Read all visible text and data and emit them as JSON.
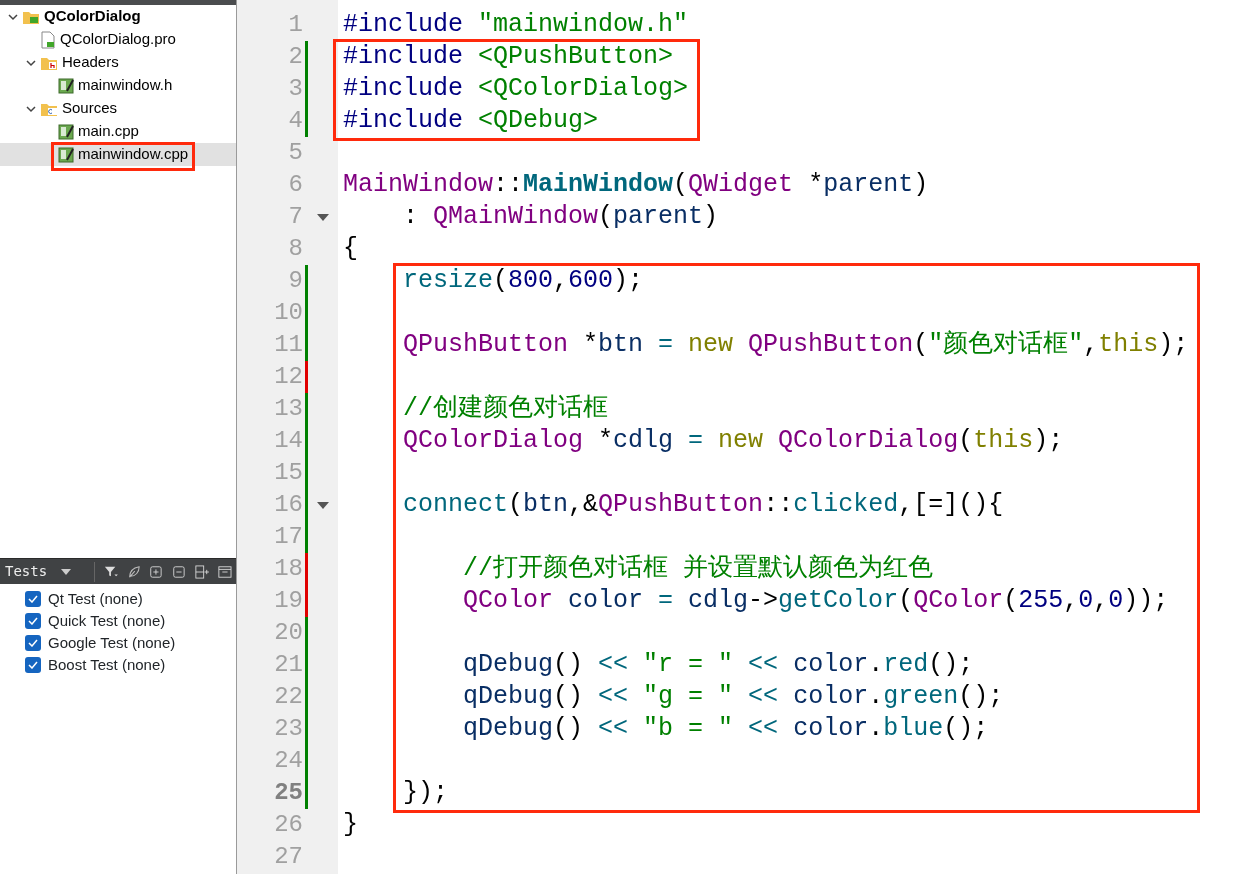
{
  "project_tree": [
    {
      "label": "QColorDialog",
      "kind": "project",
      "expanded": true,
      "selected": false,
      "highlighted": false,
      "children": [
        {
          "label": "QColorDialog.pro",
          "kind": "pro-file",
          "selected": false,
          "highlighted": false
        },
        {
          "label": "Headers",
          "kind": "header-folder",
          "expanded": true,
          "selected": false,
          "highlighted": false,
          "children": [
            {
              "label": "mainwindow.h",
              "kind": "source-file",
              "selected": false,
              "highlighted": false
            }
          ]
        },
        {
          "label": "Sources",
          "kind": "source-folder",
          "expanded": true,
          "selected": false,
          "highlighted": false,
          "children": [
            {
              "label": "main.cpp",
              "kind": "source-file",
              "selected": false,
              "highlighted": false
            },
            {
              "label": "mainwindow.cpp",
              "kind": "source-file",
              "selected": true,
              "highlighted": true
            }
          ]
        }
      ]
    }
  ],
  "tests_panel": {
    "title": "Tests",
    "items": [
      {
        "label": "Qt Test (none)",
        "checked": true
      },
      {
        "label": "Quick Test (none)",
        "checked": true
      },
      {
        "label": "Google Test (none)",
        "checked": true
      },
      {
        "label": "Boost Test (none)",
        "checked": true
      }
    ]
  },
  "editor": {
    "sections": [
      {
        "framed": false,
        "lines": [
          {
            "number": "1",
            "fold": false,
            "current": false,
            "tokens": [
              {
                "t": "#include",
                "kind": "pp"
              },
              {
                "t": " \"mainwindow.h\"",
                "kind": "str"
              }
            ]
          }
        ]
      },
      {
        "framed": true,
        "lines": [
          {
            "number": "2",
            "color": "#008000",
            "fold": false,
            "current": false,
            "tokens": [
              {
                "t": "#include",
                "kind": "pp"
              },
              {
                "t": " <QPushButton>",
                "kind": "str"
              }
            ]
          },
          {
            "number": "3",
            "color": "#008000",
            "fold": false,
            "current": false,
            "tokens": [
              {
                "t": "#include",
                "kind": "pp"
              },
              {
                "t": " <QColorDialog>",
                "kind": "str"
              }
            ]
          },
          {
            "number": "4",
            "color": "#008000",
            "fold": false,
            "current": false,
            "tokens": [
              {
                "t": "#include",
                "kind": "pp"
              },
              {
                "t": " <QDebug>",
                "kind": "str"
              }
            ]
          }
        ]
      },
      {
        "framed": false,
        "lines": [
          {
            "number": "5",
            "fold": false,
            "current": false
          },
          {
            "number": "6",
            "fold": false,
            "current": false,
            "tokens": [
              {
                "t": "MainWindow",
                "kind": "type"
              },
              {
                "t": "::",
                "kind": "plain"
              },
              {
                "t": "MainWindow",
                "kind": "funcb"
              },
              {
                "t": "(",
                "kind": "plain"
              },
              {
                "t": "QWidget",
                "kind": "type"
              },
              {
                "t": " *",
                "kind": "plain"
              },
              {
                "t": "parent",
                "kind": "var"
              },
              {
                "t": ")",
                "kind": "plain"
              }
            ]
          },
          {
            "number": "7",
            "fold": true,
            "current": false,
            "tokens": [
              {
                "t": "    :",
                "kind": "plain"
              },
              {
                "t": " QMainWindow",
                "kind": "type"
              },
              {
                "t": "(",
                "kind": "plain"
              },
              {
                "t": "parent",
                "kind": "var"
              },
              {
                "t": ")",
                "kind": "plain"
              }
            ]
          },
          {
            "number": "8",
            "fold": false,
            "current": false,
            "tokens": [
              {
                "t": "{",
                "kind": "plain"
              }
            ]
          }
        ]
      },
      {
        "framed": true,
        "lines": [
          {
            "number": "9",
            "color": "#008000",
            "fold": false,
            "current": false,
            "tokens": [
              {
                "t": "    resize",
                "kind": "func"
              },
              {
                "t": "(",
                "kind": "plain"
              },
              {
                "t": "800",
                "kind": "num"
              },
              {
                "t": ",",
                "kind": "plain"
              },
              {
                "t": "600",
                "kind": "num"
              },
              {
                "t": ");",
                "kind": "plain"
              }
            ]
          },
          {
            "number": "10",
            "color": "#008000",
            "fold": false,
            "current": false
          },
          {
            "number": "11",
            "color": "#008000",
            "fold": false,
            "current": false,
            "tokens": [
              {
                "t": "    QPushButton",
                "kind": "type"
              },
              {
                "t": " *",
                "kind": "plain"
              },
              {
                "t": "btn",
                "kind": "var"
              },
              {
                "t": " =",
                "kind": "op"
              },
              {
                "t": " new",
                "kind": "kw"
              },
              {
                "t": " QPushButton",
                "kind": "type"
              },
              {
                "t": "(",
                "kind": "plain"
              },
              {
                "t": "\"颜色对话框\"",
                "kind": "str"
              },
              {
                "t": ",",
                "kind": "plain"
              },
              {
                "t": "this",
                "kind": "kw"
              },
              {
                "t": ");",
                "kind": "plain"
              }
            ]
          },
          {
            "number": "12",
            "color": "#e00000",
            "fold": false,
            "current": false
          },
          {
            "number": "13",
            "color": "#008000",
            "fold": false,
            "current": false,
            "tokens": [
              {
                "t": "    //创建颜色对话框",
                "kind": "cmt"
              }
            ]
          },
          {
            "number": "14",
            "color": "#008000",
            "fold": false,
            "current": false,
            "tokens": [
              {
                "t": "    QColorDialog",
                "kind": "type"
              },
              {
                "t": " *",
                "kind": "plain"
              },
              {
                "t": "cdlg",
                "kind": "var"
              },
              {
                "t": " =",
                "kind": "op"
              },
              {
                "t": " new",
                "kind": "kw"
              },
              {
                "t": " QColorDialog",
                "kind": "type"
              },
              {
                "t": "(",
                "kind": "plain"
              },
              {
                "t": "this",
                "kind": "kw"
              },
              {
                "t": ");",
                "kind": "plain"
              }
            ]
          },
          {
            "number": "15",
            "color": "#008000",
            "fold": false,
            "current": false
          },
          {
            "number": "16",
            "color": "#008000",
            "fold": true,
            "current": false,
            "tokens": [
              {
                "t": "    connect",
                "kind": "func"
              },
              {
                "t": "(",
                "kind": "plain"
              },
              {
                "t": "btn",
                "kind": "var"
              },
              {
                "t": ",&",
                "kind": "plain"
              },
              {
                "t": "QPushButton",
                "kind": "type"
              },
              {
                "t": "::",
                "kind": "plain"
              },
              {
                "t": "clicked",
                "kind": "func"
              },
              {
                "t": ",[=](){",
                "kind": "plain"
              }
            ]
          },
          {
            "number": "17",
            "color": "#008000",
            "fold": false,
            "current": false
          },
          {
            "number": "18",
            "color": "#e00000",
            "fold": false,
            "current": false,
            "tokens": [
              {
                "t": "        //打开颜色对话框 并设置默认颜色为红色",
                "kind": "cmt"
              }
            ]
          },
          {
            "number": "19",
            "color": "#e00000",
            "fold": false,
            "current": false,
            "tokens": [
              {
                "t": "        QColor",
                "kind": "type"
              },
              {
                "t": " color",
                "kind": "var"
              },
              {
                "t": " =",
                "kind": "op"
              },
              {
                "t": " cdlg",
                "kind": "var"
              },
              {
                "t": "->",
                "kind": "plain"
              },
              {
                "t": "getColor",
                "kind": "func"
              },
              {
                "t": "(",
                "kind": "plain"
              },
              {
                "t": "QColor",
                "kind": "type"
              },
              {
                "t": "(",
                "kind": "plain"
              },
              {
                "t": "255",
                "kind": "num"
              },
              {
                "t": ",",
                "kind": "plain"
              },
              {
                "t": "0",
                "kind": "num"
              },
              {
                "t": ",",
                "kind": "plain"
              },
              {
                "t": "0",
                "kind": "num"
              },
              {
                "t": "));",
                "kind": "plain"
              }
            ]
          },
          {
            "number": "20",
            "color": "#008000",
            "fold": false,
            "current": false
          },
          {
            "number": "21",
            "color": "#008000",
            "fold": false,
            "current": false,
            "tokens": [
              {
                "t": "        qDebug",
                "kind": "var"
              },
              {
                "t": "()",
                "kind": "plain"
              },
              {
                "t": " <<",
                "kind": "op"
              },
              {
                "t": " \"r = \"",
                "kind": "str"
              },
              {
                "t": " <<",
                "kind": "op"
              },
              {
                "t": " color",
                "kind": "var"
              },
              {
                "t": ".",
                "kind": "plain"
              },
              {
                "t": "red",
                "kind": "func"
              },
              {
                "t": "();",
                "kind": "plain"
              }
            ]
          },
          {
            "number": "22",
            "color": "#008000",
            "fold": false,
            "current": false,
            "tokens": [
              {
                "t": "        qDebug",
                "kind": "var"
              },
              {
                "t": "()",
                "kind": "plain"
              },
              {
                "t": " <<",
                "kind": "op"
              },
              {
                "t": " \"g = \"",
                "kind": "str"
              },
              {
                "t": " <<",
                "kind": "op"
              },
              {
                "t": " color",
                "kind": "var"
              },
              {
                "t": ".",
                "kind": "plain"
              },
              {
                "t": "green",
                "kind": "func"
              },
              {
                "t": "();",
                "kind": "plain"
              }
            ]
          },
          {
            "number": "23",
            "color": "#008000",
            "fold": false,
            "current": false,
            "tokens": [
              {
                "t": "        qDebug",
                "kind": "var"
              },
              {
                "t": "()",
                "kind": "plain"
              },
              {
                "t": " <<",
                "kind": "op"
              },
              {
                "t": " \"b = \"",
                "kind": "str"
              },
              {
                "t": " <<",
                "kind": "op"
              },
              {
                "t": " color",
                "kind": "var"
              },
              {
                "t": ".",
                "kind": "plain"
              },
              {
                "t": "blue",
                "kind": "func"
              },
              {
                "t": "();",
                "kind": "plain"
              }
            ]
          },
          {
            "number": "24",
            "color": "#008000",
            "fold": false,
            "current": false
          },
          {
            "number": "25",
            "color": "#008000",
            "fold": false,
            "current": true,
            "tokens": [
              {
                "t": "    });",
                "kind": "plain"
              }
            ]
          }
        ]
      },
      {
        "framed": false,
        "lines": [
          {
            "number": "26",
            "fold": false,
            "current": false,
            "tokens": [
              {
                "t": "}",
                "kind": "plain"
              }
            ]
          },
          {
            "number": "27",
            "fold": false,
            "current": false
          }
        ]
      }
    ]
  }
}
